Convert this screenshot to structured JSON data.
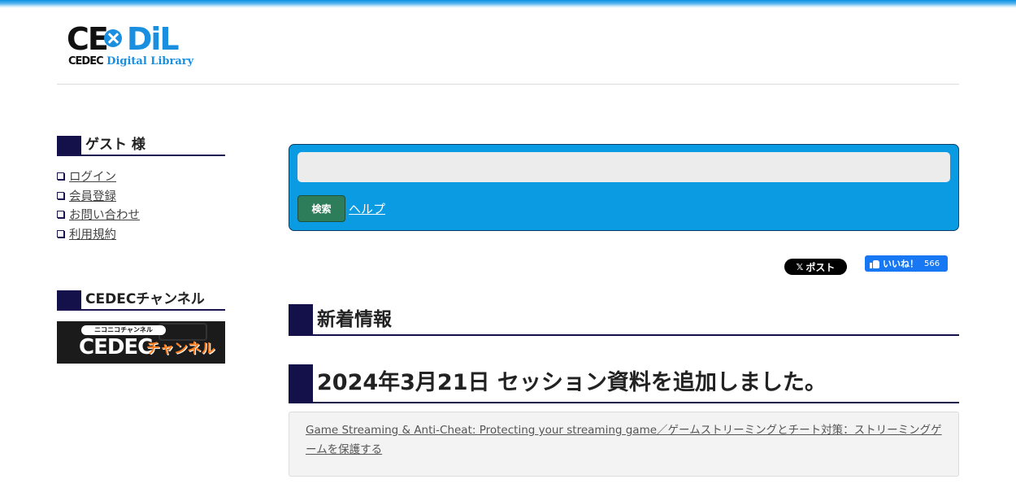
{
  "logo": {
    "main_left": "CE",
    "main_right": "DiL",
    "sub_brand": "CEDEC",
    "sub_text": "Digital Library"
  },
  "sidebar": {
    "guest_heading": "ゲスト 様",
    "links": [
      {
        "label": "ログイン"
      },
      {
        "label": "会員登録"
      },
      {
        "label": "お問い合わせ"
      },
      {
        "label": "利用規約"
      }
    ],
    "channel_heading": "CEDECチャンネル",
    "channel_banner": {
      "top_text": "ニコニコチャンネル",
      "main_text": "CEDEC",
      "kana_text": "チャンネル"
    }
  },
  "search": {
    "value": "",
    "button_label": "検索",
    "help_label": "ヘルプ"
  },
  "social": {
    "x_post_label": "ポスト",
    "fb_like_label": "いいね！",
    "fb_like_count": "566"
  },
  "news": {
    "heading": "新着情報",
    "date_heading": "2024年3月21日 セッション資料を追加しました。",
    "item_link": "Game Streaming & Anti-Cheat: Protecting your streaming game／ゲームストリーミングとチート対策：ストリーミングゲームを保護する"
  },
  "colors": {
    "accent_blue": "#0a9be3",
    "navy": "#14104a",
    "search_button": "#2e7d5a",
    "fb_blue": "#1877f2"
  }
}
